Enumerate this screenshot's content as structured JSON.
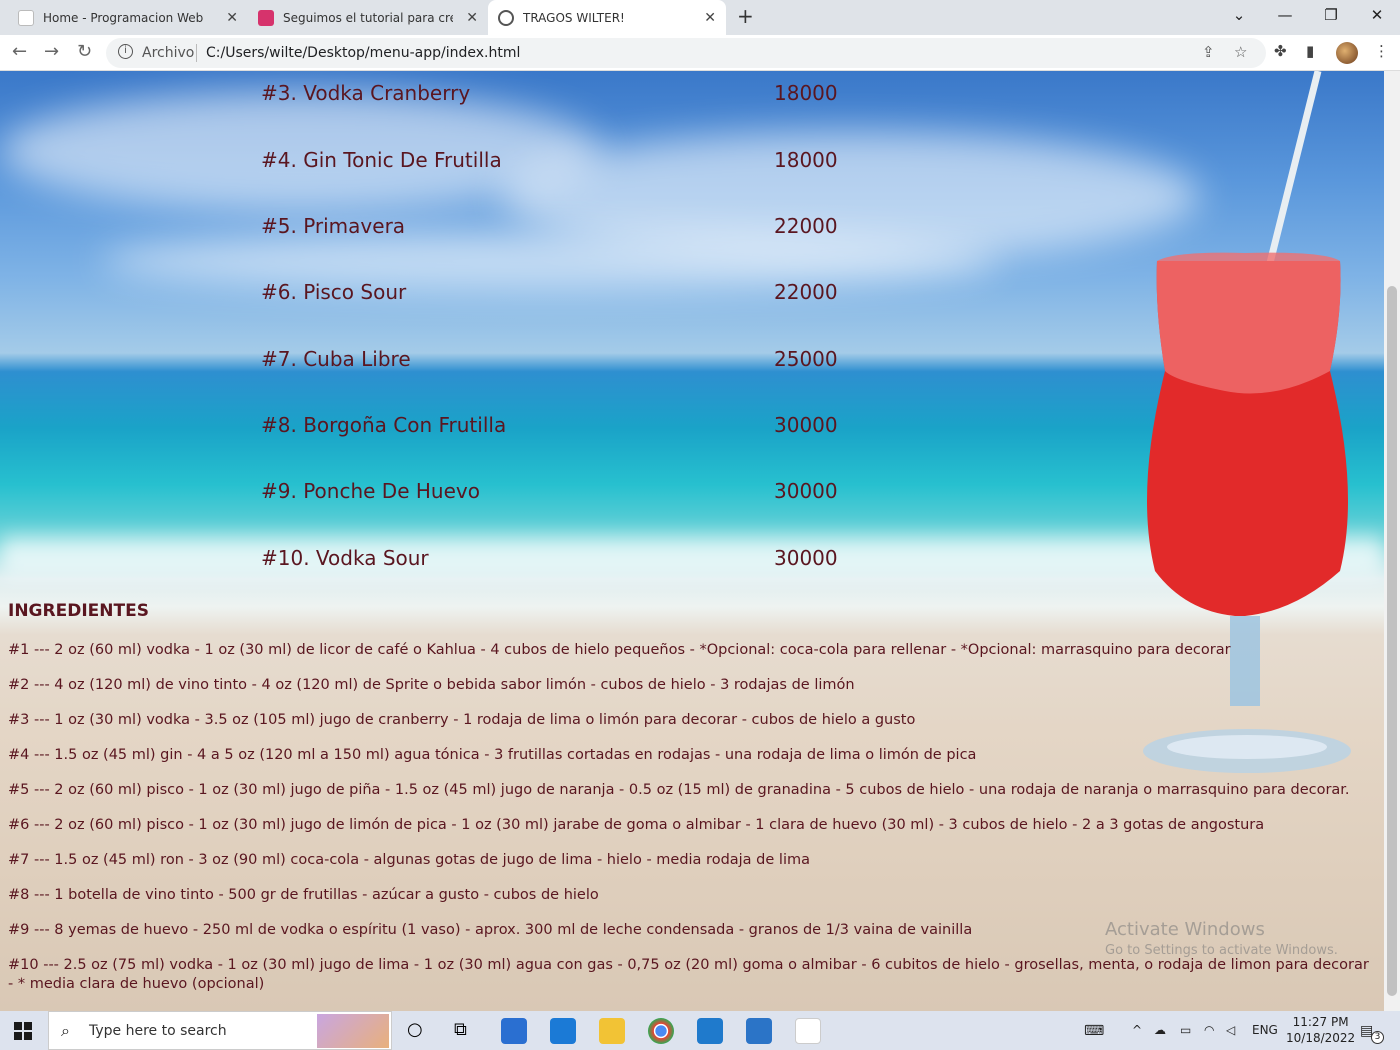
{
  "browser": {
    "tabs": [
      {
        "title": "Home - Programacion Web",
        "active": false
      },
      {
        "title": "Seguimos el tutorial para crear nu",
        "active": false
      },
      {
        "title": "TRAGOS WILTER!",
        "active": true
      }
    ],
    "url_scheme": "Archivo",
    "url": "C:/Users/wilte/Desktop/menu-app/index.html"
  },
  "menu": [
    {
      "name": "#3. Vodka Cranberry",
      "price": "18000"
    },
    {
      "name": "#4. Gin Tonic De Frutilla",
      "price": "18000"
    },
    {
      "name": "#5. Primavera",
      "price": "22000"
    },
    {
      "name": "#6. Pisco Sour",
      "price": "22000"
    },
    {
      "name": "#7. Cuba Libre",
      "price": "25000"
    },
    {
      "name": "#8. Borgoña Con Frutilla",
      "price": "30000"
    },
    {
      "name": "#9. Ponche De Huevo",
      "price": "30000"
    },
    {
      "name": "#10. Vodka Sour",
      "price": "30000"
    }
  ],
  "ingredients_title": "INGREDIENTES",
  "ingredients": [
    "#1 --- 2 oz (60 ml) vodka - 1 oz (30 ml) de licor de café o Kahlua - 4 cubos de hielo pequeños - *Opcional: coca-cola para rellenar - *Opcional: marrasquino para decorar",
    "#2 --- 4 oz (120 ml) de vino tinto - 4 oz (120 ml) de Sprite o bebida sabor limón - cubos de hielo - 3 rodajas de limón",
    "#3 --- 1 oz (30 ml) vodka - 3.5 oz (105 ml) jugo de cranberry - 1 rodaja de lima o limón para decorar - cubos de hielo a gusto",
    "#4 --- 1.5 oz (45 ml) gin - 4 a 5 oz (120 ml a 150 ml) agua tónica - 3 frutillas cortadas en rodajas - una rodaja de lima o limón de pica",
    "#5 --- 2 oz (60 ml) pisco - 1 oz (30 ml) jugo de piña - 1.5 oz (45 ml) jugo de naranja - 0.5 oz (15 ml) de granadina - 5 cubos de hielo - una rodaja de naranja o marrasquino para decorar.",
    "#6 --- 2 oz (60 ml) pisco - 1 oz (30 ml) jugo de limón de pica - 1 oz (30 ml) jarabe de goma o almibar - 1 clara de huevo (30 ml) - 3 cubos de hielo - 2 a 3 gotas de angostura",
    "#7 --- 1.5 oz (45 ml) ron - 3 oz (90 ml) coca-cola - algunas gotas de jugo de lima - hielo - media rodaja de lima",
    "#8 --- 1 botella de vino tinto - 500 gr de frutillas - azúcar a gusto - cubos de hielo",
    "#9 --- 8 yemas de huevo - 250 ml de vodka o espíritu (1 vaso) - aprox. 300 ml de leche condensada - granos de 1/3 vaina de vainilla",
    "#10 --- 2.5 oz (75 ml) vodka - 1 oz (30 ml) jugo de lima - 1 oz (30 ml) agua con gas - 0,75 oz (20 ml) goma o almibar - 6 cubitos de hielo - grosellas, menta, o rodaja de limon para decorar - * media clara de huevo (opcional)"
  ],
  "watermark": {
    "title": "Activate Windows",
    "subtitle": "Go to Settings to activate Windows."
  },
  "taskbar": {
    "search_placeholder": "Type here to search",
    "lang": "ENG",
    "time": "11:27 PM",
    "date": "10/18/2022",
    "notification_count": "3"
  }
}
